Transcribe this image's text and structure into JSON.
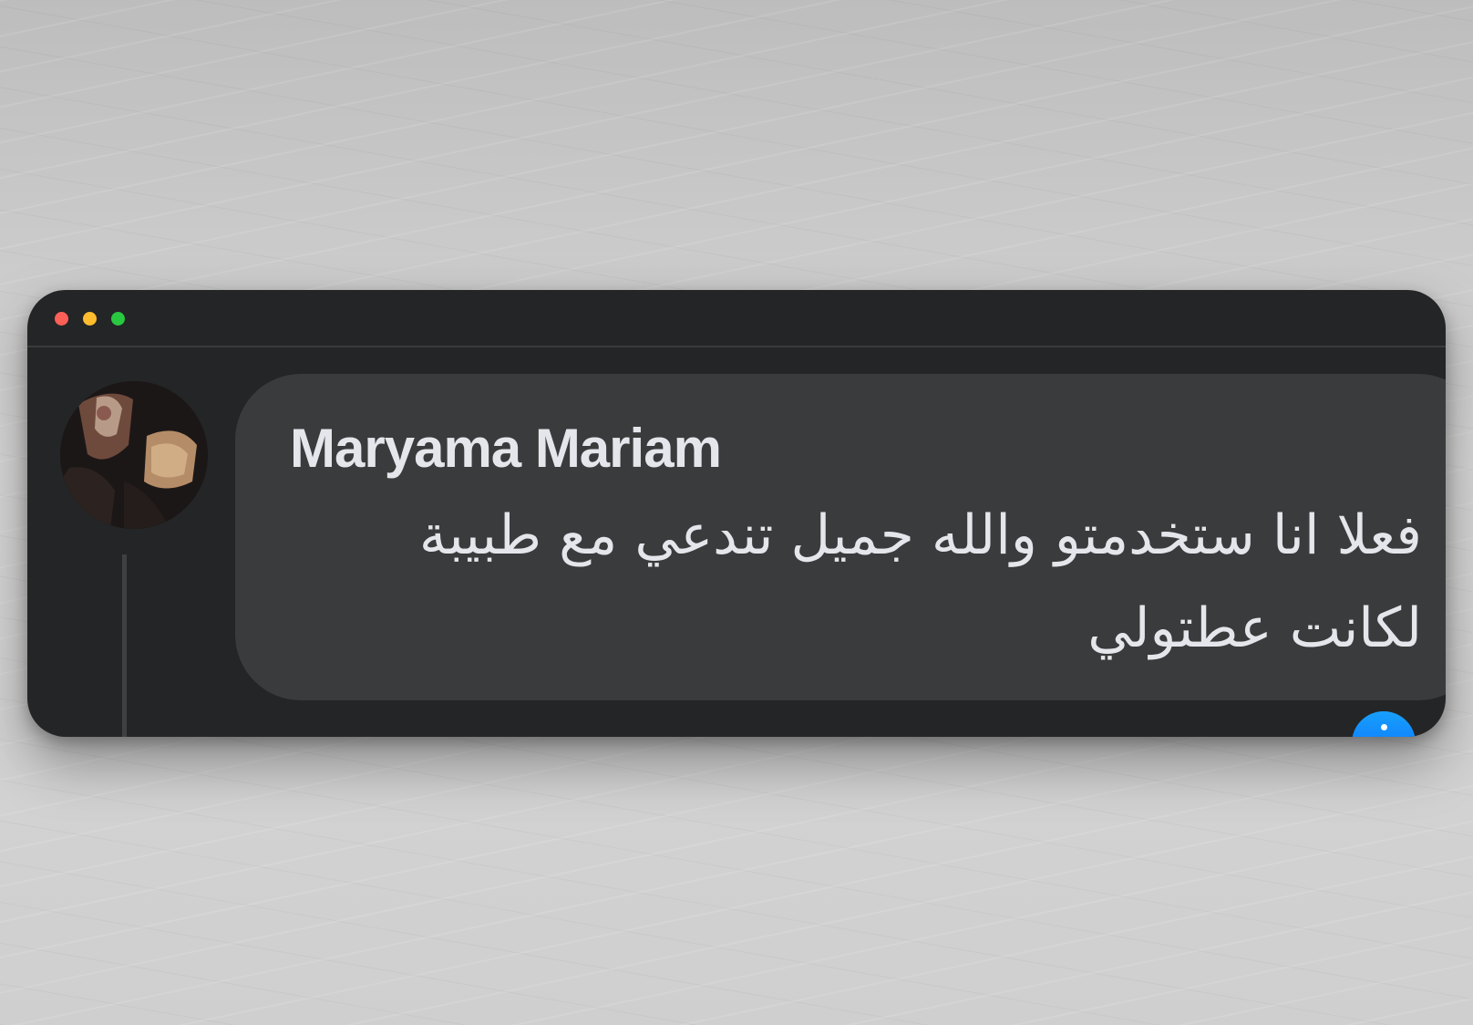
{
  "window": {
    "controls": {
      "close_color": "#fe5f57",
      "minimize_color": "#febc2e",
      "zoom_color": "#28c840"
    }
  },
  "comment": {
    "author": "Maryama Mariam",
    "text": "فعلا انا ستخدمتو والله جميل تندعي مع طبيبة لكانت عطتولي",
    "avatar_icon": "user-avatar-photo",
    "reaction_icon": "like-reaction-icon",
    "reaction_color": "#0866ff",
    "bubble_color": "#3a3b3c"
  }
}
